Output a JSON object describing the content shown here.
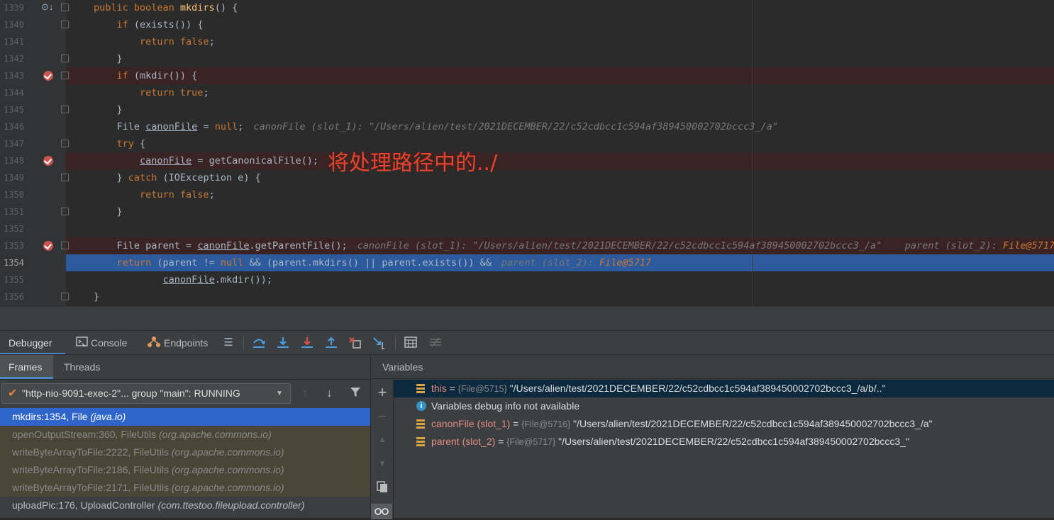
{
  "editor": {
    "lines": [
      {
        "num": "1339",
        "t": [
          [
            "kw",
            "public boolean "
          ],
          [
            "fn",
            "mkdirs"
          ],
          [
            "p",
            "() {"
          ]
        ]
      },
      {
        "num": "1340",
        "t": [
          [
            "p",
            "    "
          ],
          [
            "kw",
            "if"
          ],
          [
            "p",
            " (exists()) {"
          ]
        ]
      },
      {
        "num": "1341",
        "t": [
          [
            "p",
            "        "
          ],
          [
            "kw",
            "return false"
          ],
          [
            "p",
            ";"
          ]
        ]
      },
      {
        "num": "1342",
        "t": [
          [
            "p",
            "    }"
          ]
        ]
      },
      {
        "num": "1343",
        "t": [
          [
            "p",
            "    "
          ],
          [
            "kw",
            "if"
          ],
          [
            "p",
            " (mkdir()) {"
          ]
        ]
      },
      {
        "num": "1344",
        "t": [
          [
            "p",
            "        "
          ],
          [
            "kw",
            "return true"
          ],
          [
            "p",
            ";"
          ]
        ]
      },
      {
        "num": "1345",
        "t": [
          [
            "p",
            "    }"
          ]
        ]
      },
      {
        "num": "1346",
        "t": [
          [
            "p",
            "    File "
          ],
          [
            "ul",
            "canonFile"
          ],
          [
            "p",
            " = "
          ],
          [
            "kw",
            "null"
          ],
          [
            "p",
            ";"
          ]
        ],
        "hint": [
          [
            "hv",
            "canonFile (slot_1): \"/Users/alien/test/2021DECEMBER/22/c52cdbcc1c594af389450002702bccc3_/a\""
          ]
        ]
      },
      {
        "num": "1347",
        "t": [
          [
            "p",
            "    "
          ],
          [
            "kw",
            "try"
          ],
          [
            "p",
            " {"
          ]
        ]
      },
      {
        "num": "1348",
        "t": [
          [
            "p",
            "        "
          ],
          [
            "ul",
            "canonFile"
          ],
          [
            "p",
            " = getCanonicalFile();"
          ]
        ]
      },
      {
        "num": "1349",
        "t": [
          [
            "p",
            "    } "
          ],
          [
            "kw",
            "catch"
          ],
          [
            "p",
            " (IOException e) {"
          ]
        ]
      },
      {
        "num": "1350",
        "t": [
          [
            "p",
            "        "
          ],
          [
            "kw",
            "return false"
          ],
          [
            "p",
            ";"
          ]
        ]
      },
      {
        "num": "1351",
        "t": [
          [
            "p",
            "    }"
          ]
        ]
      },
      {
        "num": "1352",
        "t": []
      },
      {
        "num": "1353",
        "t": [
          [
            "p",
            "    File parent = "
          ],
          [
            "ul",
            "canonFile"
          ],
          [
            "p",
            ".getParentFile();"
          ]
        ],
        "hint": [
          [
            "hv",
            "canonFile (slot_1): \"/Users/alien/test/2021DECEMBER/22/c52cdbcc1c594af389450002702bccc3_/a\"    parent (slot_2): "
          ],
          [
            "obj",
            "File@5717"
          ]
        ]
      },
      {
        "num": "1354",
        "t": [
          [
            "p",
            "    "
          ],
          [
            "kw",
            "return"
          ],
          [
            "p",
            " (parent != "
          ],
          [
            "kw",
            "null"
          ],
          [
            "p",
            " && (parent.mkdirs() || parent.exists()) &&"
          ]
        ],
        "hint": [
          [
            "hv",
            "parent (slot_2): "
          ],
          [
            "obj",
            "File@5717"
          ]
        ]
      },
      {
        "num": "1355",
        "t": [
          [
            "p",
            "            "
          ],
          [
            "ul",
            "canonFile"
          ],
          [
            "p",
            ".mkdir());"
          ]
        ]
      },
      {
        "num": "1356",
        "t": [
          [
            "p",
            "}"
          ]
        ]
      }
    ],
    "annotation": "将处理路径中的../"
  },
  "debugger": {
    "tabs": {
      "debugger": "Debugger",
      "console": "Console",
      "endpoints": "Endpoints"
    },
    "subtabs": {
      "frames": "Frames",
      "threads": "Threads"
    },
    "variables_header": "Variables",
    "thread_selector": "\"http-nio-9091-exec-2\"... group \"main\": RUNNING",
    "frames": [
      {
        "method": "mkdirs:1354, File ",
        "pkg": "(java.io)"
      },
      {
        "method": "openOutputStream:360, FileUtils ",
        "pkg": "(org.apache.commons.io)"
      },
      {
        "method": "writeByteArrayToFile:2222, FileUtils ",
        "pkg": "(org.apache.commons.io)"
      },
      {
        "method": "writeByteArrayToFile:2186, FileUtils ",
        "pkg": "(org.apache.commons.io)"
      },
      {
        "method": "writeByteArrayToFile:2171, FileUtils ",
        "pkg": "(org.apache.commons.io)"
      },
      {
        "method": "uploadPic:176, UploadController ",
        "pkg": "(com.ttestoo.fileupload.controller)"
      }
    ],
    "variables": [
      {
        "name": "this",
        "eq": " = ",
        "type": "{File@5715}",
        "value": " \"/Users/alien/test/2021DECEMBER/22/c52cdbcc1c594af389450002702bccc3_/a/b/..\""
      },
      {
        "info": "Variables debug info not available"
      },
      {
        "name": "canonFile (slot_1)",
        "eq": " = ",
        "type": "{File@5716}",
        "value": " \"/Users/alien/test/2021DECEMBER/22/c52cdbcc1c594af389450002702bccc3_/a\""
      },
      {
        "name": "parent (slot_2)",
        "eq": " = ",
        "type": "{File@5717}",
        "value": " \"/Users/alien/test/2021DECEMBER/22/c52cdbcc1c594af389450002702bccc3_\""
      }
    ]
  },
  "colors": {
    "keyword": "#cc7832",
    "function": "#ffc66d",
    "current_line": "#2d5a9c",
    "breakpoint_line": "#3a2323",
    "breakpoint": "#c75450",
    "annotation": "#e8432c"
  }
}
